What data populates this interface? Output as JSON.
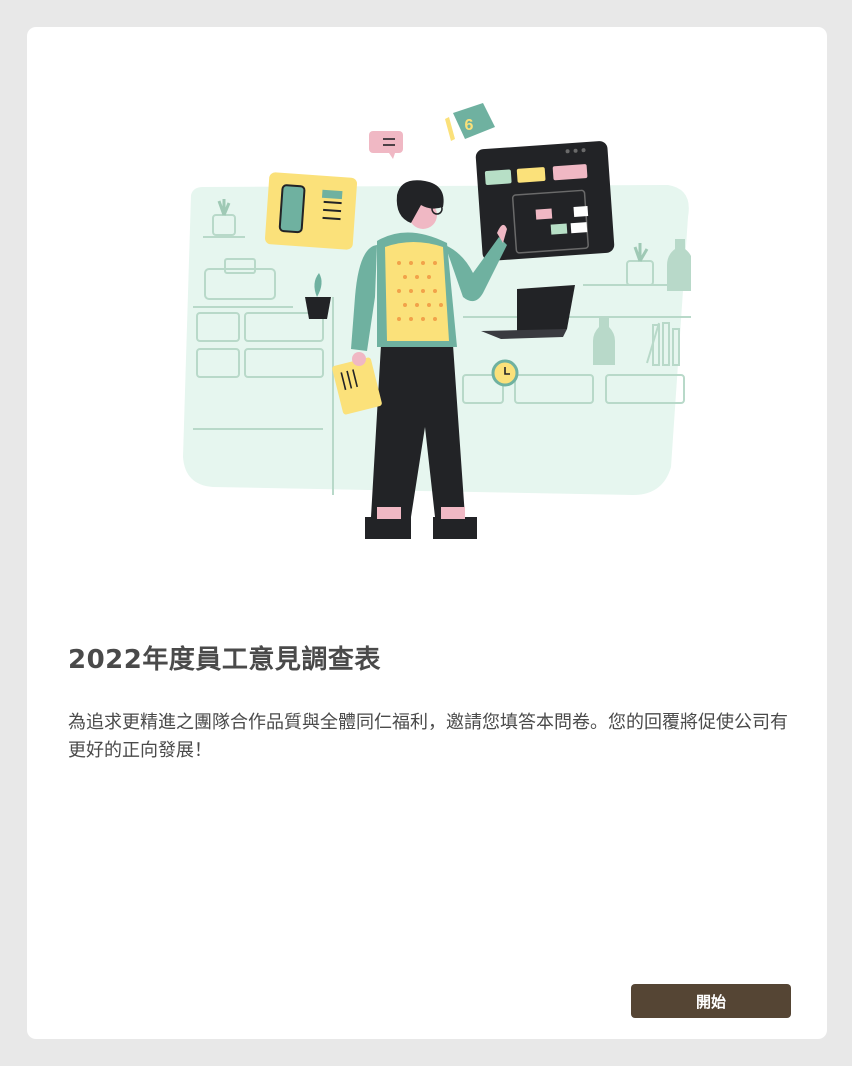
{
  "survey": {
    "title": "2022年度員工意見調查表",
    "description": "為追求更精進之團隊合作品質與全體同仁福利，邀請您填答本問卷。您的回覆將促使公司有更好的正向發展！",
    "start_label": "開始"
  },
  "illustration": {
    "calendar_badge": "6"
  },
  "colors": {
    "page_background": "#e8e8e8",
    "card_background": "#ffffff",
    "button_background": "#554534",
    "button_text": "#ffffff",
    "text": "#4a4a4a"
  }
}
